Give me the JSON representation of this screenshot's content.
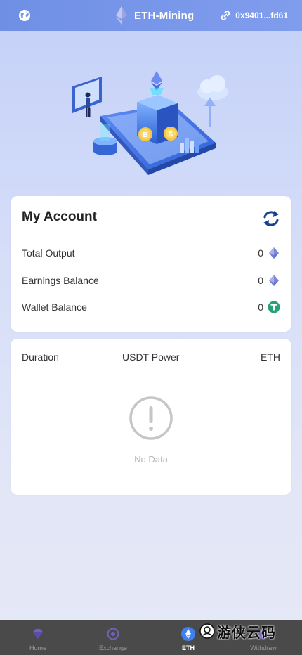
{
  "header": {
    "title": "ETH-Mining",
    "address": "0x9401...fd61",
    "icons": {
      "left": "globe-icon",
      "title": "ethereum-logo",
      "address": "link-icon"
    }
  },
  "hero": {
    "icon": "mining-illustration"
  },
  "account": {
    "heading": "My Account",
    "refresh_icon": "refresh-icon",
    "rows": [
      {
        "label": "Total Output",
        "value": "0",
        "icon": "eth-coin-icon"
      },
      {
        "label": "Earnings Balance",
        "value": "0",
        "icon": "eth-coin-icon"
      },
      {
        "label": "Wallet Balance",
        "value": "0",
        "icon": "usdt-coin-icon"
      }
    ]
  },
  "records": {
    "columns": [
      "Duration",
      "USDT Power",
      "ETH"
    ],
    "empty_text": "No Data",
    "empty_icon": "exclamation-circle-icon"
  },
  "tabbar": {
    "tabs": [
      {
        "label": "Home",
        "icon": "gem-icon",
        "active": false
      },
      {
        "label": "Exchange",
        "icon": "exchange-icon",
        "active": false
      },
      {
        "label": "ETH",
        "icon": "eth-icon",
        "active": true
      },
      {
        "label": "Withdraw",
        "icon": "withdraw-icon",
        "active": false
      }
    ]
  },
  "watermark": {
    "text": "游侠云码"
  },
  "colors": {
    "header": "#7a98ea",
    "tabbar": "#4a4a4b",
    "usdt": "#26a17b",
    "eth": "#6f7fd8"
  }
}
